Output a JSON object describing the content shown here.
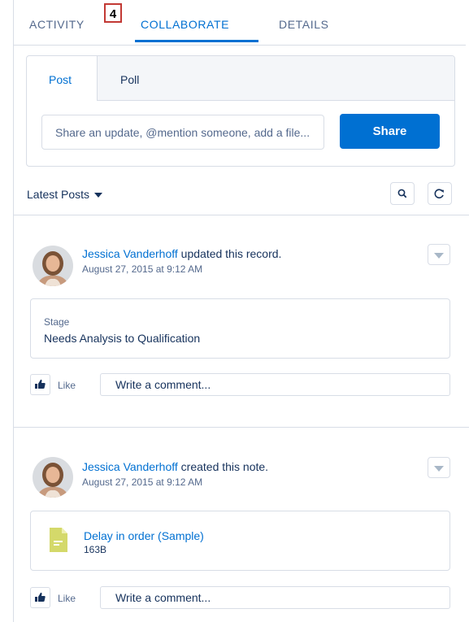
{
  "tabs": [
    {
      "label": "Activity"
    },
    {
      "label": "Collaborate"
    },
    {
      "label": "Details"
    }
  ],
  "callout": "4",
  "publisher": {
    "tabs": [
      {
        "label": "Post"
      },
      {
        "label": "Poll"
      }
    ],
    "input_placeholder": "Share an update, @mention someone, add a file...",
    "share_label": "Share"
  },
  "feed": {
    "sort_label": "Latest Posts",
    "items": [
      {
        "author": "Jessica Vanderhoff",
        "action": " updated this record.",
        "timestamp": "August 27, 2015 at 9:12 AM",
        "field_label": "Stage",
        "field_value": "Needs Analysis to Qualification",
        "like_label": "Like",
        "comment_placeholder": "Write a comment..."
      },
      {
        "author": "Jessica Vanderhoff",
        "action": " created this note.",
        "timestamp": "August 27, 2015 at 9:12 AM",
        "file_name": "Delay in order (Sample)",
        "file_size": "163B",
        "like_label": "Like",
        "comment_placeholder": "Write a comment..."
      }
    ]
  },
  "colors": {
    "accent": "#0070d2",
    "callout_border": "#c23934",
    "note_icon": "#d4d96a"
  }
}
